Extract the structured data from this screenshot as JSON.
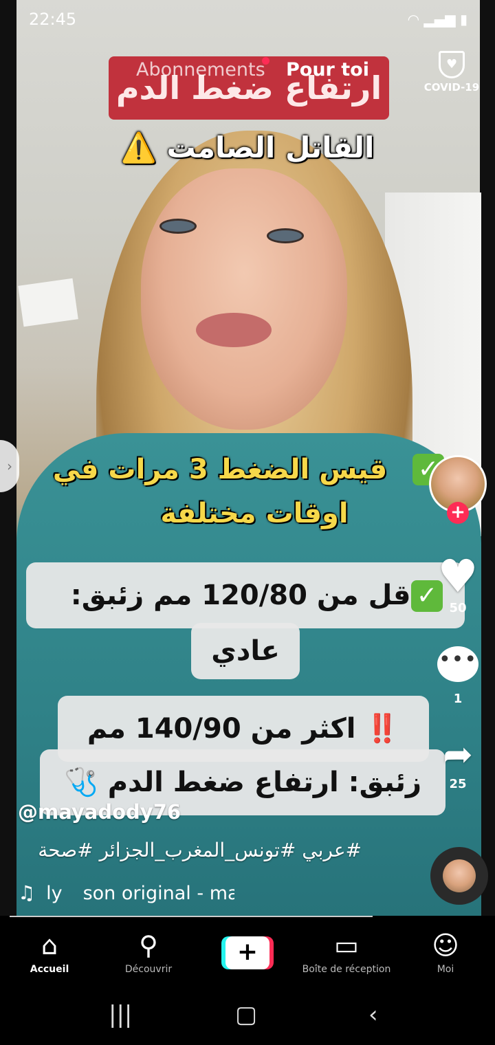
{
  "status_bar": {
    "time": "22:45",
    "icons": "wifi signal battery"
  },
  "tabs": {
    "following": "Abonnements",
    "for_you": "Pour toi"
  },
  "covid": {
    "label": "COVID-19"
  },
  "video_text": {
    "red_title": "ارتفاع ضغط الدم",
    "subtitle": "⚠️ القاتل الصامت",
    "line1": "قيس الضغط 3 مرات في",
    "line2": "اوقات مختلفة",
    "box1_line1": "اقل من 120/80 مم زئبق:",
    "box1_line2": "عادي",
    "box2_line1": "‼️ اكثر من 140/90 مم",
    "box2_line2": "زئبق: ارتفاع ضغط الدم 🩺"
  },
  "rail": {
    "likes": "50",
    "comments": "1",
    "shares": "25"
  },
  "post": {
    "username": "@mayadody76",
    "hashtags": "#عربي  #تونس_المغرب_الجزائر #صحة",
    "music_prefix": "ly",
    "music_track": "son original - ma"
  },
  "bottom_nav": {
    "home": "Accueil",
    "discover": "Découvrir",
    "inbox": "Boîte de réception",
    "me": "Moi"
  },
  "icons": {
    "home": "home-icon",
    "discover": "search-icon",
    "create": "plus-icon",
    "inbox": "inbox-icon",
    "me": "profile-icon",
    "like": "heart-icon",
    "comment": "comment-icon",
    "share": "share-icon",
    "covid": "shield-icon"
  },
  "colors": {
    "accent": "#fe2c55",
    "cyan": "#25f4ee",
    "caption_red": "#c1323d",
    "caption_yellow": "#f6d84a"
  }
}
